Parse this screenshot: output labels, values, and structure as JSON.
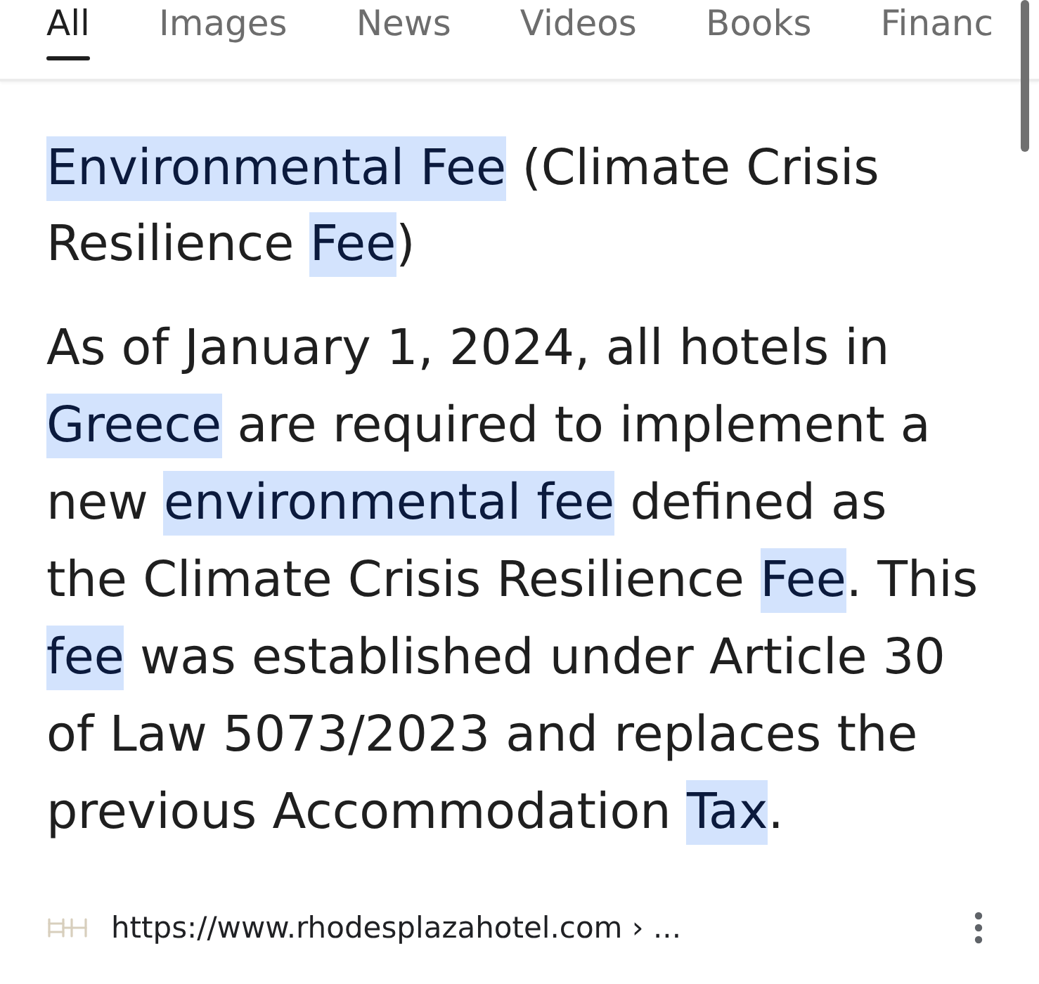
{
  "tabs": [
    {
      "label": "All",
      "selected": true
    },
    {
      "label": "Images",
      "selected": false
    },
    {
      "label": "News",
      "selected": false
    },
    {
      "label": "Videos",
      "selected": false
    },
    {
      "label": "Books",
      "selected": false
    },
    {
      "label": "Financ",
      "selected": false
    }
  ],
  "result": {
    "heading": [
      {
        "text": "Environmental Fee",
        "highlight": true
      },
      {
        "text": " (Climate Crisis Resilience ",
        "highlight": false
      },
      {
        "text": "Fee",
        "highlight": true
      },
      {
        "text": ")",
        "highlight": false
      }
    ],
    "snippet": [
      {
        "text": "As of January 1, 2024, all hotels in ",
        "highlight": false
      },
      {
        "text": "Greece",
        "highlight": true
      },
      {
        "text": " are required to implement a new ",
        "highlight": false
      },
      {
        "text": "environmental fee",
        "highlight": true
      },
      {
        "text": " defined as the Climate Crisis Resilience ",
        "highlight": false
      },
      {
        "text": "Fee",
        "highlight": true
      },
      {
        "text": ". This ",
        "highlight": false
      },
      {
        "text": "fee",
        "highlight": true
      },
      {
        "text": " was established under Article 30 of Law 5073/2023 and replaces the previous Accommodation ",
        "highlight": false
      },
      {
        "text": "Tax",
        "highlight": true
      },
      {
        "text": ".",
        "highlight": false
      }
    ],
    "source": {
      "url": "https://www.rhodesplazahotel.com › ..."
    }
  }
}
